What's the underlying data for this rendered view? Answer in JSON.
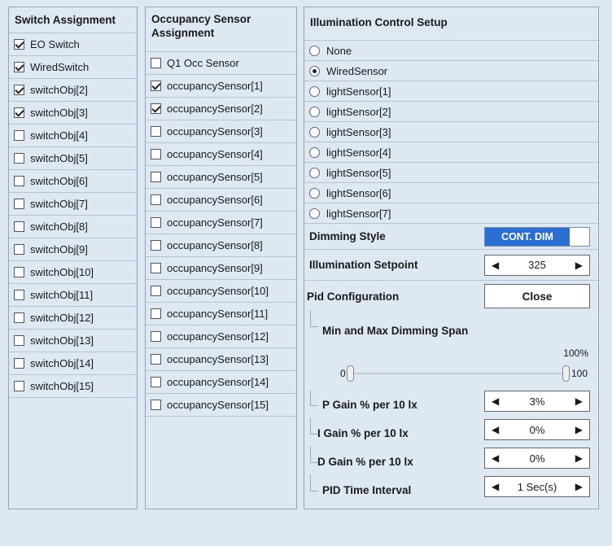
{
  "switch": {
    "title": "Switch Assignment",
    "items": [
      {
        "label": "EO Switch",
        "checked": true
      },
      {
        "label": "WiredSwitch",
        "checked": true
      },
      {
        "label": "switchObj[2]",
        "checked": true
      },
      {
        "label": "switchObj[3]",
        "checked": true
      },
      {
        "label": "switchObj[4]",
        "checked": false
      },
      {
        "label": "switchObj[5]",
        "checked": false
      },
      {
        "label": "switchObj[6]",
        "checked": false
      },
      {
        "label": "switchObj[7]",
        "checked": false
      },
      {
        "label": "switchObj[8]",
        "checked": false
      },
      {
        "label": "switchObj[9]",
        "checked": false
      },
      {
        "label": "switchObj[10]",
        "checked": false
      },
      {
        "label": "switchObj[11]",
        "checked": false
      },
      {
        "label": "switchObj[12]",
        "checked": false
      },
      {
        "label": "switchObj[13]",
        "checked": false
      },
      {
        "label": "switchObj[14]",
        "checked": false
      },
      {
        "label": "switchObj[15]",
        "checked": false
      }
    ]
  },
  "occupancy": {
    "title_line1": "Occupancy Sensor",
    "title_line2": "Assignment",
    "items": [
      {
        "label": "Q1 Occ Sensor",
        "checked": false
      },
      {
        "label": "occupancySensor[1]",
        "checked": true
      },
      {
        "label": "occupancySensor[2]",
        "checked": true
      },
      {
        "label": "occupancySensor[3]",
        "checked": false
      },
      {
        "label": "occupancySensor[4]",
        "checked": false
      },
      {
        "label": "occupancySensor[5]",
        "checked": false
      },
      {
        "label": "occupancySensor[6]",
        "checked": false
      },
      {
        "label": "occupancySensor[7]",
        "checked": false
      },
      {
        "label": "occupancySensor[8]",
        "checked": false
      },
      {
        "label": "occupancySensor[9]",
        "checked": false
      },
      {
        "label": "occupancySensor[10]",
        "checked": false
      },
      {
        "label": "occupancySensor[11]",
        "checked": false
      },
      {
        "label": "occupancySensor[12]",
        "checked": false
      },
      {
        "label": "occupancySensor[13]",
        "checked": false
      },
      {
        "label": "occupancySensor[14]",
        "checked": false
      },
      {
        "label": "occupancySensor[15]",
        "checked": false
      }
    ]
  },
  "illumination": {
    "title": "Illumination Control Setup",
    "options": [
      {
        "label": "None",
        "selected": false
      },
      {
        "label": "WiredSensor",
        "selected": true
      },
      {
        "label": "lightSensor[1]",
        "selected": false
      },
      {
        "label": "lightSensor[2]",
        "selected": false
      },
      {
        "label": "lightSensor[3]",
        "selected": false
      },
      {
        "label": "lightSensor[4]",
        "selected": false
      },
      {
        "label": "lightSensor[5]",
        "selected": false
      },
      {
        "label": "lightSensor[6]",
        "selected": false
      },
      {
        "label": "lightSensor[7]",
        "selected": false
      }
    ],
    "dimming_style_label": "Dimming Style",
    "dimming_style_value": "CONT. DIM",
    "setpoint_label": "Illumination Setpoint",
    "setpoint_value": "325",
    "pid_label": "Pid Configuration",
    "pid_button": "Close",
    "span_label": "Min and Max Dimming Span",
    "span_max_pct": "100%",
    "span_min": "0",
    "span_max": "100",
    "p_gain_label": "P Gain % per 10 lx",
    "p_gain_value": "3%",
    "i_gain_label": "I Gain % per 10 lx",
    "i_gain_value": "0%",
    "d_gain_label": "D Gain % per 10 lx",
    "d_gain_value": "0%",
    "interval_label": "PID Time Interval",
    "interval_value": "1 Sec(s)",
    "arrow_left": "◀",
    "arrow_right": "▶"
  }
}
